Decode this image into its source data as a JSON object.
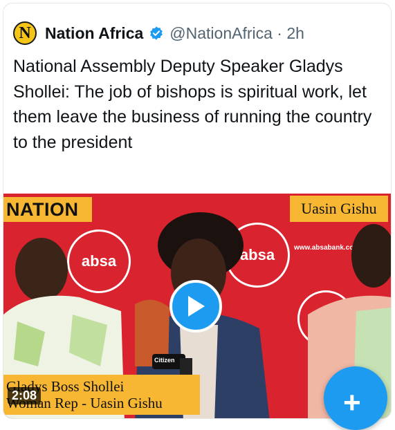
{
  "tweet": {
    "avatar_letter": "N",
    "author_name": "Nation Africa",
    "handle_time": "@NationAfrica · 2h",
    "text": "National Assembly Deputy Speaker Gladys Shollei: The job of bishops is spiritual work, let them leave the business of running the country to the president"
  },
  "media": {
    "nation_logo": "NATION",
    "location": "Uasin Gishu",
    "name_line1": "Gladys Boss Shollei",
    "name_line2": "Woman Rep - Uasin Gishu",
    "duration": "2:08",
    "banner_logo_text": "absa",
    "banner_url": "www.absabank.co.ke",
    "mic_label": "Citizen"
  },
  "fab": {
    "label": "+"
  },
  "colors": {
    "accent": "#1d9bf0",
    "banner_red": "#d9232e",
    "tag_orange": "#f7b733"
  },
  "icons": [
    "verified-badge-icon",
    "play-icon",
    "compose-icon"
  ]
}
